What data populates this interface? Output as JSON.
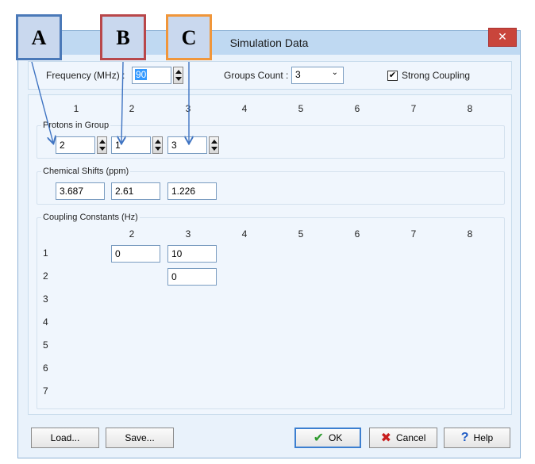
{
  "window": {
    "title": "Simulation Data",
    "close_glyph": "✕"
  },
  "annotations": {
    "a": "A",
    "b": "B",
    "c": "C"
  },
  "top": {
    "frequency_label": "Frequency (MHz) :",
    "frequency_value": "90",
    "groups_count_label": "Groups Count :",
    "groups_count_value": "3",
    "strong_coupling_label": "Strong Coupling",
    "strong_coupling_checked": true
  },
  "columns": [
    "1",
    "2",
    "3",
    "4",
    "5",
    "6",
    "7",
    "8"
  ],
  "protons": {
    "label": "Protons in Group",
    "values": [
      "2",
      "1",
      "3"
    ]
  },
  "shifts": {
    "label": "Chemical Shifts (ppm)",
    "values": [
      "3.687",
      "2.61",
      "1.226"
    ]
  },
  "coupling": {
    "label": "Coupling Constants (Hz)",
    "col_headers": [
      "2",
      "3",
      "4",
      "5",
      "6",
      "7",
      "8"
    ],
    "row_labels": [
      "1",
      "2",
      "3",
      "4",
      "5",
      "6",
      "7"
    ],
    "j12": "0",
    "j13": "10",
    "j23": "0"
  },
  "buttons": {
    "load": "Load...",
    "save": "Save...",
    "ok": "OK",
    "cancel": "Cancel",
    "help": "Help"
  },
  "colors": {
    "annot_a": "#4a79b8",
    "annot_b": "#b8474a",
    "annot_c": "#f0963a",
    "arrow": "#3f74c2"
  }
}
